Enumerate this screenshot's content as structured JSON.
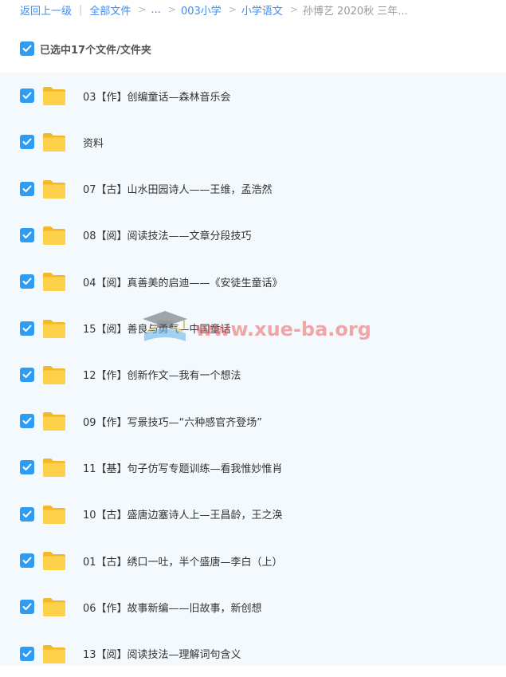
{
  "breadcrumb": {
    "back": "返回上一级",
    "all_files": "全部文件",
    "ellipsis": "...",
    "c3": "003小学",
    "c4": "小学语文",
    "current": "孙博艺 2020秋 三年..."
  },
  "selection": {
    "label": "已选中17个文件/文件夹"
  },
  "rows": [
    "03【作】创编童话—森林音乐会",
    "资料",
    "07【古】山水田园诗人——王维，孟浩然",
    "08【阅】阅读技法——文章分段技巧",
    "04【阅】真善美的启迪——《安徒生童话》",
    "15【阅】善良与勇气—中国童话",
    "12【作】创新作文—我有一个想法",
    "09【作】写景技巧—“六种感官齐登场”",
    "11【基】句子仿写专题训练—看我惟妙惟肖",
    "10【古】盛唐边塞诗人上—王昌龄，王之涣",
    "01【古】绣口一吐，半个盛唐—李白（上）",
    "06【作】故事新编——旧故事，新创想",
    "13【阅】阅读技法—理解词句含义"
  ],
  "watermark": {
    "text": "www.xue-ba.org",
    "icon": "graduation-cap-book-icon"
  },
  "colors": {
    "accent": "#3b8cf5",
    "checkbox": "#2f9cf4",
    "folder": "#fbc531",
    "list_bg": "#f3f9fd"
  }
}
